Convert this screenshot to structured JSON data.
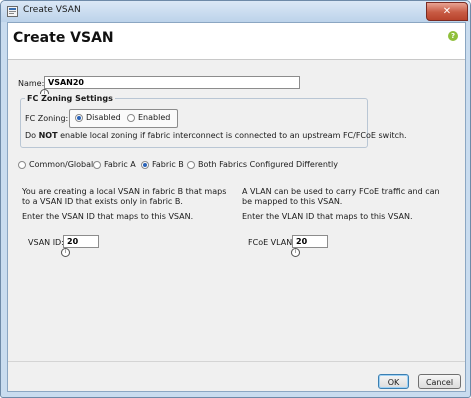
{
  "window": {
    "title": "Create VSAN",
    "close_glyph": "✕"
  },
  "dialog": {
    "title": "Create VSAN",
    "help_glyph": "?"
  },
  "name": {
    "label": "Name:",
    "value": "VSAN20"
  },
  "fc_zoning": {
    "legend": "FC Zoning Settings",
    "label": "FC Zoning:",
    "options": [
      "Disabled",
      "Enabled"
    ],
    "selected": "Disabled",
    "warning_prefix": "Do ",
    "warning_bold": "NOT",
    "warning_suffix": " enable local zoning if fabric interconnect is connected to an upstream FC/FCoE switch."
  },
  "fabric": {
    "options": [
      "Common/Global",
      "Fabric A",
      "Fabric B",
      "Both Fabrics Configured Differently"
    ],
    "selected": "Fabric B"
  },
  "left_panel": {
    "description": "You are creating a local VSAN in fabric B that maps to a VSAN ID that exists only in fabric B.",
    "instruction": "Enter the VSAN ID that maps to this VSAN.",
    "field_label": "VSAN ID:",
    "value": "20"
  },
  "right_panel": {
    "description": "A VLAN can be used to carry FCoE traffic and can be mapped to this VSAN.",
    "instruction": "Enter the VLAN ID that maps to this VSAN.",
    "field_label": "FCoE VLAN:",
    "value": "20"
  },
  "buttons": {
    "ok": "OK",
    "cancel": "Cancel"
  },
  "icons": {
    "app": "vsan-app-icon",
    "help": "help-icon",
    "info": "info-icon"
  },
  "colors": {
    "titlebar": "#c9dcef",
    "close": "#c75a43",
    "radio_selected": "#2a63b8",
    "help": "#8fbf3a"
  }
}
